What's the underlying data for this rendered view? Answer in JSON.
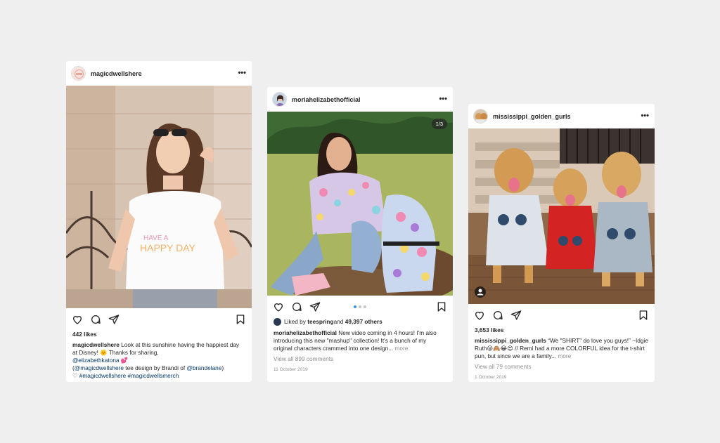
{
  "posts": [
    {
      "username": "magicdwellshere",
      "more_icon": "more-horizontal-icon",
      "likes": "442 likes",
      "caption_user": "magicdwellshere",
      "caption_line1": " Look at this sunshine having the happiest day at Disney! ",
      "caption_emoji1": "🌞",
      "caption_line2": " Thanks for sharing, ",
      "caption_mention1": "@elizabethkatona",
      "caption_emoji2": " 💕",
      "caption_open_paren": " (",
      "caption_mention2": "@magicdwellshere",
      "caption_mid": " tee design by Brandi of ",
      "caption_mention3": "@brandelane",
      "caption_close_paren": ")",
      "caption_heart": "♡ ",
      "caption_hashtags": "#magicdwellshere #magicdwellsmerch",
      "photo_colors": {
        "bg": "#d8c6b6",
        "shirt": "#fafafa",
        "hair": "#5a3a26"
      }
    },
    {
      "username": "moriahelizabethofficial",
      "counter": "1/3",
      "liked_by_prefix": "Liked by ",
      "liked_by_user": "teespring",
      "liked_by_mid": " and ",
      "liked_by_others": "49,397 others",
      "caption_user": "moriahelizabethofficial",
      "caption_text": " New video coming in 4 hours! I'm also introducing this new \"mashup\" collection! It's a bunch of my original characters crammed into one design...",
      "more_link": " more",
      "view_comments": "View all 899 comments",
      "date": "11 October 2019"
    },
    {
      "username": "mississippi_golden_gurls",
      "likes": "3,653 likes",
      "caption_user": "mississippi_golden_gurls",
      "caption_text": " “We \"SHIRT\" do love you guys!” ~Idgie Ruth😝🙈😂😍 // Remi had a more COLORFUL idea for the t-shirt pun, but since we are a family...",
      "more_link": " more",
      "view_comments": "View all 79 comments",
      "date": "1 October 2019"
    }
  ],
  "colors": {
    "accent": "#3897f0",
    "link": "#00376b",
    "muted": "#8e8e8e",
    "page_bg": "#efefef"
  }
}
